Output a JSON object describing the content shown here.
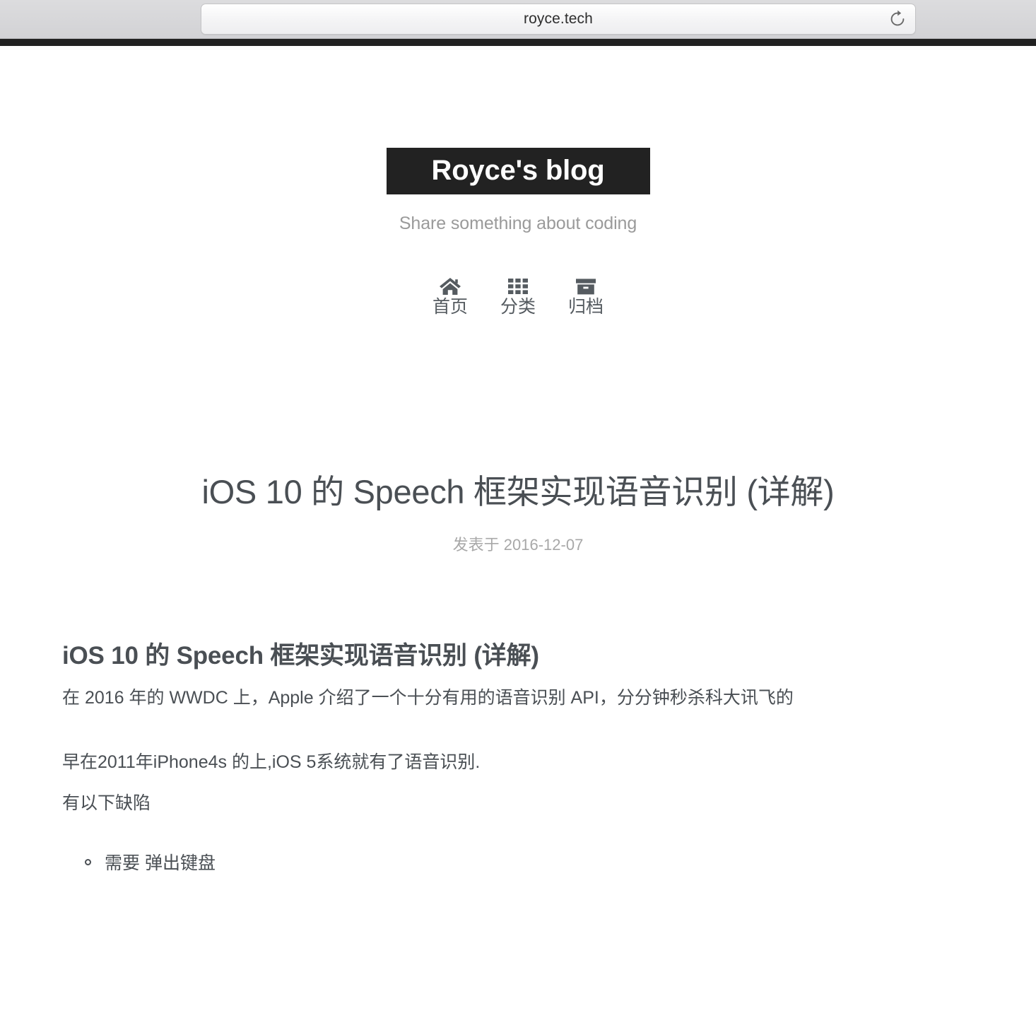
{
  "browser": {
    "url": "royce.tech",
    "reload_icon": "reload-icon"
  },
  "site": {
    "title": "Royce's blog",
    "subtitle": "Share something about coding",
    "banner_color": "#222222",
    "subtitle_color": "#9a9a9a"
  },
  "nav": {
    "items": [
      {
        "icon": "home-icon",
        "label": "首页"
      },
      {
        "icon": "grid-icon",
        "label": "分类"
      },
      {
        "icon": "archive-box-icon",
        "label": "归档"
      }
    ]
  },
  "post": {
    "title": "iOS 10 的 Speech 框架实现语音识别 (详解)",
    "date_prefix": "发表于",
    "date": "2016-12-07",
    "date_line": "发表于 2016-12-07",
    "body": {
      "heading": "iOS 10 的 Speech 框架实现语音识别 (详解)",
      "paragraph_1": "在 2016 年的 WWDC 上，Apple 介绍了一个十分有用的语音识别 API，分分钟秒杀科大讯飞的",
      "paragraph_2": "早在2011年iPhone4s 的上,iOS 5系统就有了语音识别.",
      "paragraph_3": "有以下缺陷",
      "list": [
        "需要 弹出键盘"
      ]
    }
  },
  "colors": {
    "text": "#4a4f54",
    "muted": "#a8a8a8",
    "nav": "#555b60"
  }
}
